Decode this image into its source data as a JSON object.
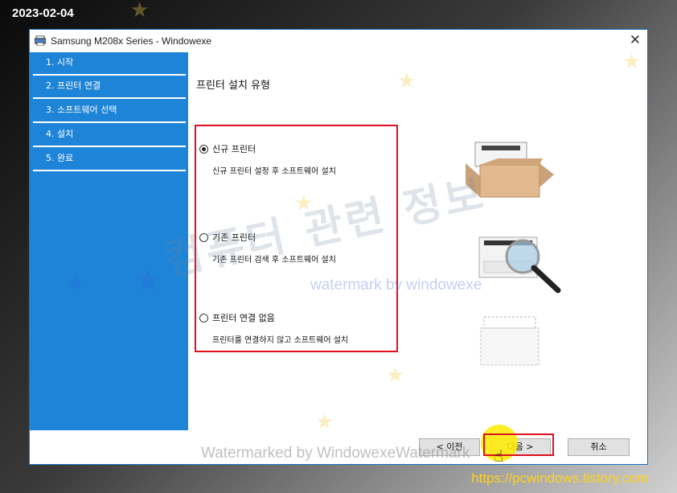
{
  "overlay": {
    "date": "2023-02-04",
    "site_url": "https://pcwindows.tistory.com",
    "watermark_korean": "컴퓨터 관련 정보",
    "watermark_small": "watermark by windowexe",
    "watermark_bottom": "Watermarked by WindowexeWatermark"
  },
  "window": {
    "title": "Samsung M208x Series   - Windowexe",
    "close_glyph": "✕"
  },
  "sidebar": {
    "steps": [
      {
        "label": "1. 시작"
      },
      {
        "label": "2. 프린터 연결"
      },
      {
        "label": "3. 소프트웨어 선택"
      },
      {
        "label": "4. 설치"
      },
      {
        "label": "5. 완료"
      }
    ]
  },
  "main": {
    "heading": "프린터 설치 유형",
    "options": [
      {
        "label": "신규 프린터",
        "description": "신규 프린터 설정 후 소프트웨어 설치",
        "selected": true,
        "icon": "printer-in-box-icon"
      },
      {
        "label": "기존 프린터",
        "description": "기존 프린터 검색 후 소프트웨어 설치",
        "selected": false,
        "icon": "printer-magnifier-icon"
      },
      {
        "label": "프린터 연결 없음",
        "description": "프린터를 연결하지 않고 소프트웨어 설치",
        "selected": false,
        "icon": "printer-outline-icon"
      }
    ]
  },
  "footer": {
    "back_label": "< 이전",
    "next_label": "다음 >",
    "cancel_label": "취소"
  },
  "colors": {
    "sidebar_bg": "#1e84d8",
    "highlight_red": "#e0101e",
    "url_yellow": "#ffd21e"
  }
}
